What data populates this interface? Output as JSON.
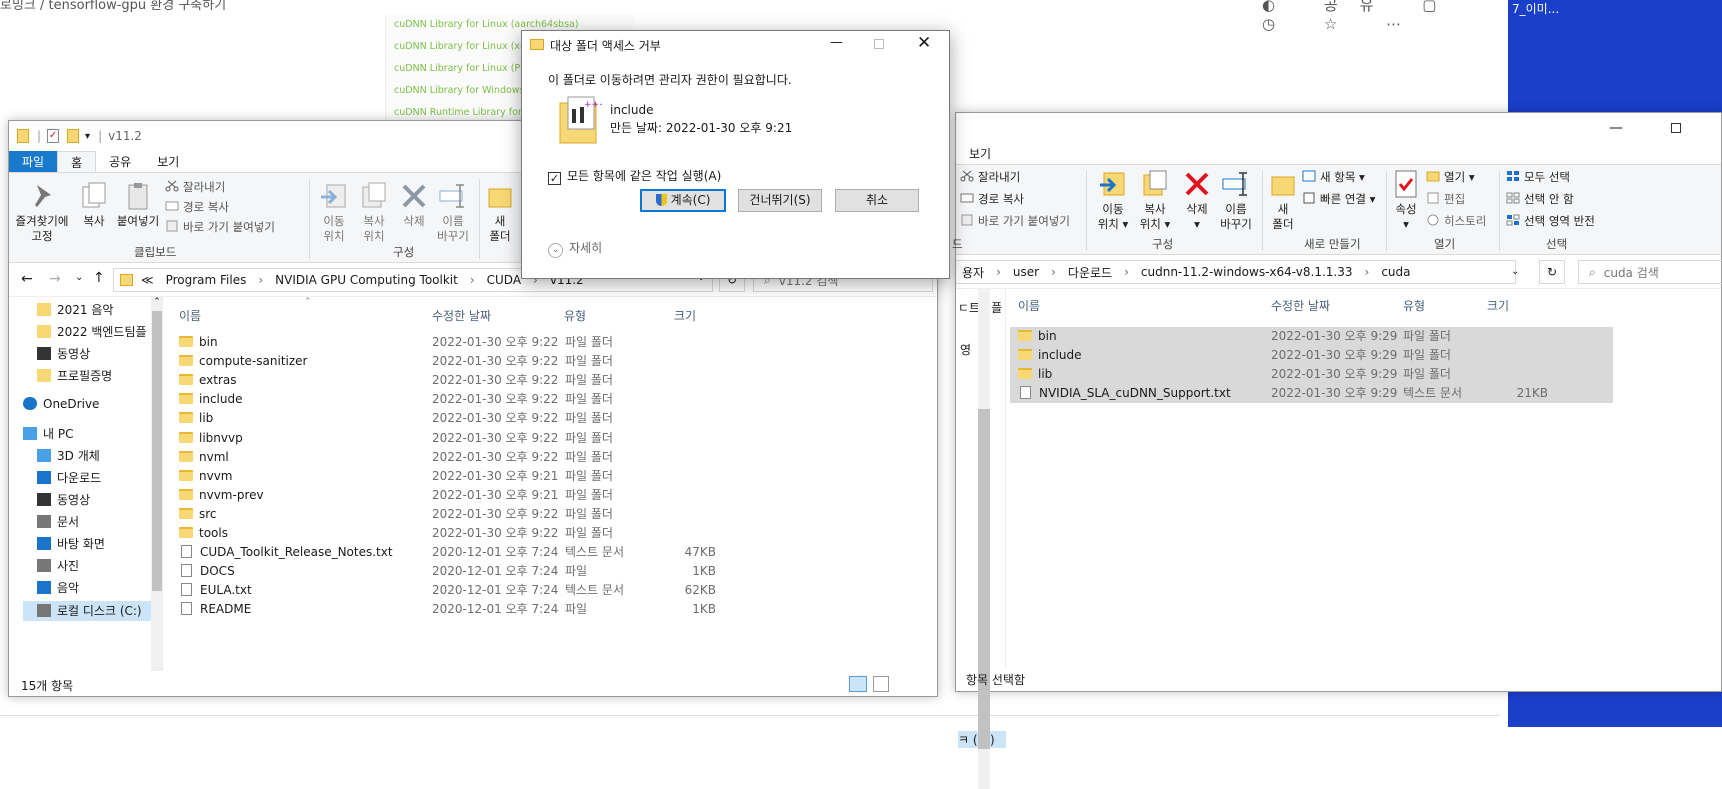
{
  "browser": {
    "breadcrumb": "로밍크  /  tensorflow-gpu 환경 구축하기",
    "top_icons": "◐ 공유 ▢ ◷ ☆ ⋯",
    "links": [
      "cuDNN Library for Linux (aarch64sbsa)",
      "cuDNN Library for Linux (x86_64)",
      "cuDNN Library for Linux (PPC)",
      "cuDNN Library for Windows (x86)",
      "cuDNN Runtime Library for Ubuntu"
    ]
  },
  "desktop": {
    "label": "7_이미..."
  },
  "left_window": {
    "title": "v11.2",
    "tabs": [
      "파일",
      "홈",
      "공유",
      "보기"
    ],
    "ribbon": {
      "pin": "즐겨찾기에\n고정",
      "copy": "복사",
      "paste": "붙여넣기",
      "cut": "잘라내기",
      "copy_path": "경로 복사",
      "paste_shortcut": "바로 가기 붙여넣기",
      "group_clipboard": "클립보드",
      "move_to": "이동\n위치",
      "copy_to": "복사\n위치",
      "delete": "삭제",
      "rename": "이름\n바꾸기",
      "group_organize": "구성",
      "new_folder": "새\n폴더",
      "group_new": "새"
    },
    "address": [
      "≪",
      "Program Files",
      "›",
      "NVIDIA GPU Computing Toolkit",
      "›",
      "CUDA",
      "›",
      "v11.2"
    ],
    "search_placeholder": "v11.2 검색",
    "nav": [
      {
        "label": "2021 음악",
        "icon": "folder"
      },
      {
        "label": "2022 백엔드팀플",
        "icon": "folder"
      },
      {
        "label": "동영상",
        "icon": "video"
      },
      {
        "label": "프로필증명",
        "icon": "folder"
      },
      {
        "label": "OneDrive",
        "icon": "cloud"
      },
      {
        "label": "내 PC",
        "icon": "pc"
      },
      {
        "label": "3D 개체",
        "icon": "cube"
      },
      {
        "label": "다운로드",
        "icon": "download"
      },
      {
        "label": "동영상",
        "icon": "video"
      },
      {
        "label": "문서",
        "icon": "doc"
      },
      {
        "label": "바탕 화면",
        "icon": "desktop"
      },
      {
        "label": "사진",
        "icon": "photo"
      },
      {
        "label": "음악",
        "icon": "music"
      },
      {
        "label": "로컬 디스크 (C:)",
        "icon": "disk"
      }
    ],
    "columns": [
      "이름",
      "수정한 날짜",
      "유형",
      "크기"
    ],
    "files": [
      {
        "name": "bin",
        "date": "2022-01-30 오후 9:22",
        "type": "파일 폴더",
        "size": "",
        "kind": "folder"
      },
      {
        "name": "compute-sanitizer",
        "date": "2022-01-30 오후 9:22",
        "type": "파일 폴더",
        "size": "",
        "kind": "folder"
      },
      {
        "name": "extras",
        "date": "2022-01-30 오후 9:22",
        "type": "파일 폴더",
        "size": "",
        "kind": "folder"
      },
      {
        "name": "include",
        "date": "2022-01-30 오후 9:22",
        "type": "파일 폴더",
        "size": "",
        "kind": "folder"
      },
      {
        "name": "lib",
        "date": "2022-01-30 오후 9:22",
        "type": "파일 폴더",
        "size": "",
        "kind": "folder"
      },
      {
        "name": "libnvvp",
        "date": "2022-01-30 오후 9:22",
        "type": "파일 폴더",
        "size": "",
        "kind": "folder"
      },
      {
        "name": "nvml",
        "date": "2022-01-30 오후 9:22",
        "type": "파일 폴더",
        "size": "",
        "kind": "folder"
      },
      {
        "name": "nvvm",
        "date": "2022-01-30 오후 9:21",
        "type": "파일 폴더",
        "size": "",
        "kind": "folder"
      },
      {
        "name": "nvvm-prev",
        "date": "2022-01-30 오후 9:21",
        "type": "파일 폴더",
        "size": "",
        "kind": "folder"
      },
      {
        "name": "src",
        "date": "2022-01-30 오후 9:22",
        "type": "파일 폴더",
        "size": "",
        "kind": "folder"
      },
      {
        "name": "tools",
        "date": "2022-01-30 오후 9:22",
        "type": "파일 폴더",
        "size": "",
        "kind": "folder"
      },
      {
        "name": "CUDA_Toolkit_Release_Notes.txt",
        "date": "2020-12-01 오후 7:24",
        "type": "텍스트 문서",
        "size": "47KB",
        "kind": "doc"
      },
      {
        "name": "DOCS",
        "date": "2020-12-01 오후 7:24",
        "type": "파일",
        "size": "1KB",
        "kind": "doc"
      },
      {
        "name": "EULA.txt",
        "date": "2020-12-01 오후 7:24",
        "type": "텍스트 문서",
        "size": "62KB",
        "kind": "doc"
      },
      {
        "name": "README",
        "date": "2020-12-01 오후 7:24",
        "type": "파일",
        "size": "1KB",
        "kind": "doc"
      }
    ],
    "status": "15개 항목"
  },
  "right_window": {
    "tab_view": "보기",
    "ribbon": {
      "cut": "잘라내기",
      "copy_path": "경로 복사",
      "paste_shortcut": "바로 가기 붙여넣기",
      "group_clip_tail": "드",
      "move_to": "이동\n위치 ▾",
      "copy_to": "복사\n위치 ▾",
      "delete": "삭제\n▾",
      "rename": "이름\n바꾸기",
      "group_organize": "구성",
      "new_folder": "새\n폴더",
      "new_item": "새 항목 ▾",
      "easy_access": "빠른 연결 ▾",
      "group_new": "새로 만들기",
      "properties": "속성\n▾",
      "open": "열기 ▾",
      "edit": "편집",
      "history": "히스토리",
      "group_open": "열기",
      "select_all": "모두 선택",
      "select_none": "선택 안 함",
      "invert": "선택 영역 반전",
      "group_select": "선택"
    },
    "address": [
      "용자",
      "›",
      "user",
      "›",
      "다운로드",
      "›",
      "cudnn-11.2-windows-x64-v8.1.1.33",
      "›",
      "cuda"
    ],
    "search_placeholder": "cuda 검색",
    "nav_partial": [
      "ㄷ트팀플",
      "영",
      "ㅋ (C:)"
    ],
    "columns": [
      "이름",
      "수정한 날짜",
      "유형",
      "크기"
    ],
    "files": [
      {
        "name": "bin",
        "date": "2022-01-30 오후 9:29",
        "type": "파일 폴더",
        "size": "",
        "kind": "folder"
      },
      {
        "name": "include",
        "date": "2022-01-30 오후 9:29",
        "type": "파일 폴더",
        "size": "",
        "kind": "folder"
      },
      {
        "name": "lib",
        "date": "2022-01-30 오후 9:29",
        "type": "파일 폴더",
        "size": "",
        "kind": "folder"
      },
      {
        "name": "NVIDIA_SLA_cuDNN_Support.txt",
        "date": "2022-01-30 오후 9:29",
        "type": "텍스트 문서",
        "size": "21KB",
        "kind": "doc"
      }
    ],
    "status": "항목 선택함"
  },
  "dialog": {
    "title": "대상 폴더 액세스 거부",
    "message": "이 폴더로 이동하려면 관리자 권한이 필요합니다.",
    "item_name": "include",
    "item_date": "만든 날짜: 2022-01-30 오후 9:21",
    "checkbox": "모든 항목에 같은 작업 실행(A)",
    "continue": "계속(C)",
    "skip": "건너뛰기(S)",
    "cancel": "취소",
    "details": "자세히"
  }
}
